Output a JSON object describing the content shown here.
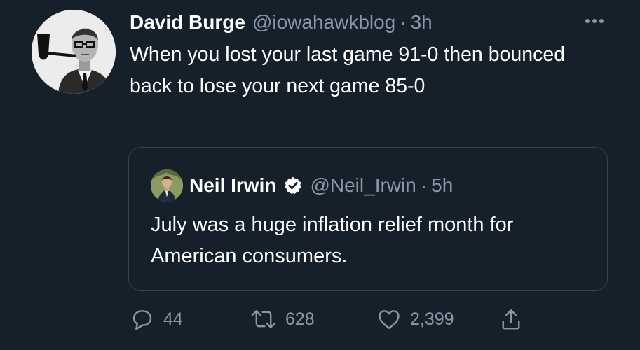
{
  "tweet": {
    "author_name": "David Burge",
    "author_handle": "@iowahawkblog",
    "separator": "·",
    "time": "3h",
    "text": "When you lost your last game 91-0 then bounced back to lose your next game 85-0"
  },
  "quoted_tweet": {
    "author_name": "Neil Irwin",
    "author_handle": "@Neil_Irwin",
    "separator": "·",
    "time": "5h",
    "verified": true,
    "text": "July was a huge inflation relief month for American consumers."
  },
  "actions": {
    "replies": "44",
    "retweets": "628",
    "likes": "2,399"
  },
  "icons": {
    "more": "more-horizontal-icon",
    "reply": "reply-icon",
    "retweet": "retweet-icon",
    "like": "heart-icon",
    "share": "share-icon",
    "verified": "verified-badge-icon"
  },
  "colors": {
    "background": "#15202b",
    "secondary_text": "#8899a6",
    "border": "#38444d",
    "verified": "#ffffff"
  }
}
